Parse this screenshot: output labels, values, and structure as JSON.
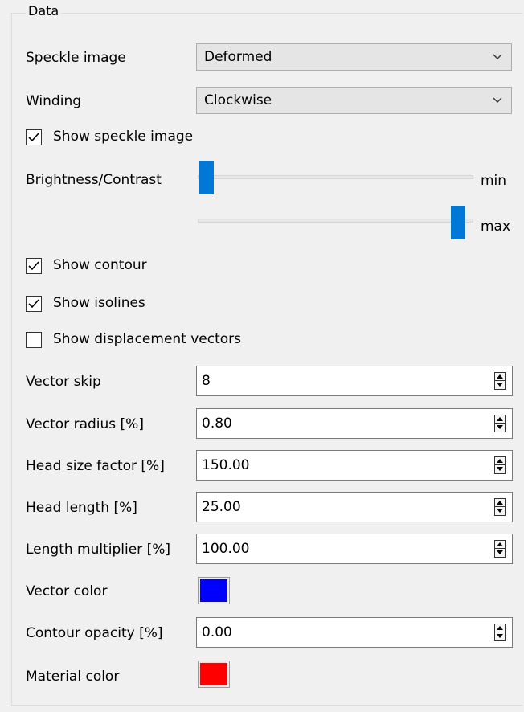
{
  "group": {
    "title": "Data"
  },
  "speckle_image": {
    "label": "Speckle image",
    "value": "Deformed"
  },
  "winding": {
    "label": "Winding",
    "value": "Clockwise"
  },
  "show_speckle_image": {
    "label": "Show speckle image",
    "checked": true
  },
  "brightness_contrast": {
    "label": "Brightness/Contrast",
    "min_label": "min",
    "max_label": "max",
    "min_value": 0.0,
    "max_value": 1.0
  },
  "show_contour": {
    "label": "Show contour",
    "checked": true
  },
  "show_isolines": {
    "label": "Show isolines",
    "checked": true
  },
  "show_displacement_vectors": {
    "label": "Show displacement vectors",
    "checked": false
  },
  "vector_skip": {
    "label": "Vector skip",
    "value": "8"
  },
  "vector_radius": {
    "label": "Vector radius [%]",
    "value": "0.80"
  },
  "head_size_factor": {
    "label": "Head size factor [%]",
    "value": "150.00"
  },
  "head_length": {
    "label": "Head length [%]",
    "value": "25.00"
  },
  "length_multiplier": {
    "label": "Length multiplier [%]",
    "value": "100.00"
  },
  "vector_color": {
    "label": "Vector color",
    "color": "#0000ff"
  },
  "contour_opacity": {
    "label": "Contour opacity [%]",
    "value": "0.00"
  },
  "material_color": {
    "label": "Material color",
    "color": "#ff0000"
  },
  "colors": {
    "accent": "#0078d7",
    "background": "#f0f0f0"
  }
}
